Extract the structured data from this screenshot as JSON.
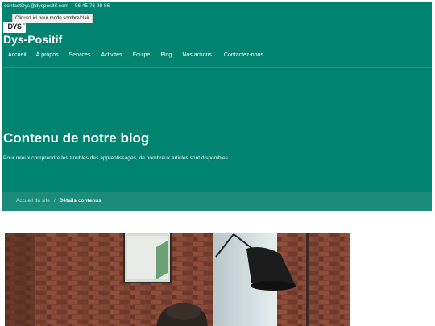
{
  "topbar": {
    "email": "contactDys@dyspositif.com",
    "phone": "06 45 76 98 86"
  },
  "contrast_button": "Cliquez ici pour mode sombre/clair",
  "logo": {
    "text": "DYS",
    "mark": "®"
  },
  "site_title": "Dys-Positif",
  "nav": {
    "items": [
      "Accueil",
      "À propos",
      "Services",
      "Activités",
      "Équipe",
      "Blog",
      "Nos actions",
      "Contactez-nous"
    ]
  },
  "hero": {
    "title": "Contenu de notre blog",
    "subtitle": "Pour mieux comprendre les troubles des apprentissages, de nombreux articles sont disponibles"
  },
  "breadcrumb": {
    "home": "Accueil du site",
    "separator": "/",
    "current": "Détails contenus"
  },
  "colors": {
    "primary": "#008471",
    "breadcrumb_bar": "#1b8b7b",
    "contrast_button_bg": "#f2f2f2"
  },
  "image": {
    "subject": "photo of a person at a desk in front of a brick wall with a black desk lamp"
  }
}
